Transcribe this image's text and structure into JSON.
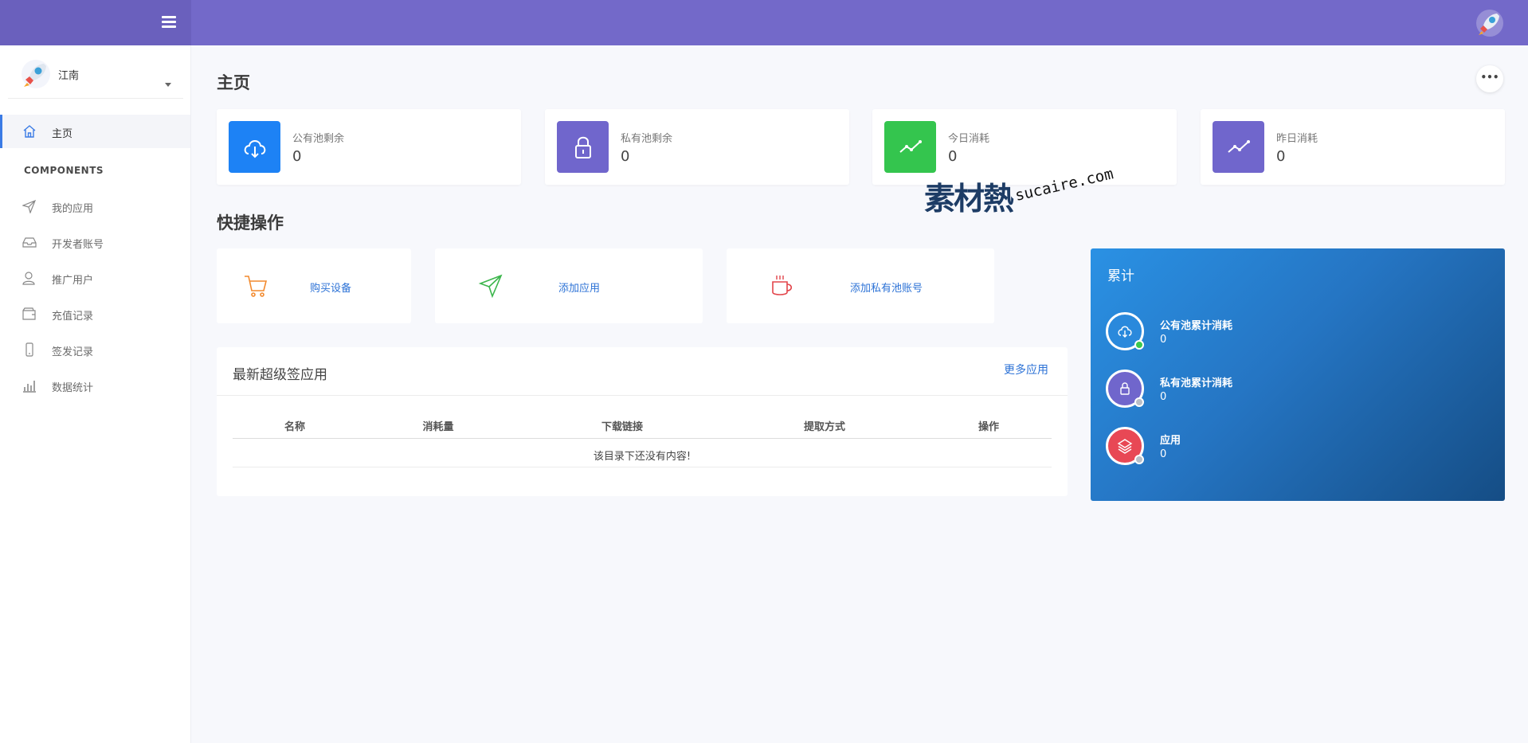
{
  "header": {
    "menu_icon": "menu-icon",
    "avatar_icon": "rocket-avatar-icon"
  },
  "sidebar": {
    "user_name": "江南",
    "active": {
      "label": "主页",
      "icon": "home-icon"
    },
    "section": "COMPONENTS",
    "items": [
      {
        "label": "我的应用",
        "icon": "send-icon"
      },
      {
        "label": "开发者账号",
        "icon": "inbox-icon"
      },
      {
        "label": "推广用户",
        "icon": "user-icon"
      },
      {
        "label": "充值记录",
        "icon": "wallet-icon"
      },
      {
        "label": "签发记录",
        "icon": "phone-icon"
      },
      {
        "label": "数据统计",
        "icon": "bar-chart-icon"
      }
    ]
  },
  "page": {
    "title": "主页",
    "more_icon": "more-icon"
  },
  "stats": [
    {
      "label": "公有池剩余",
      "value": "0",
      "icon": "cloud-download-icon",
      "color": "#1d82f5"
    },
    {
      "label": "私有池剩余",
      "value": "0",
      "icon": "lock-icon",
      "color": "#7066cc"
    },
    {
      "label": "今日消耗",
      "value": "0",
      "icon": "trend-icon",
      "color": "#34c54e"
    },
    {
      "label": "昨日消耗",
      "value": "0",
      "icon": "trend-icon",
      "color": "#7066cc"
    }
  ],
  "quick": {
    "title": "快捷操作",
    "items": [
      {
        "label": "购买设备",
        "icon": "cart-icon",
        "color": "#f28a2e"
      },
      {
        "label": "添加应用",
        "icon": "send-icon",
        "color": "#3cb64c"
      },
      {
        "label": "添加私有池账号",
        "icon": "cup-icon",
        "color": "#e2454b"
      }
    ]
  },
  "apps": {
    "title": "最新超级签应用",
    "more": "更多应用",
    "columns": [
      "名称",
      "消耗量",
      "下载链接",
      "提取方式",
      "操作"
    ],
    "empty": "该目录下还没有内容!"
  },
  "accum": {
    "title": "累计",
    "items": [
      {
        "label": "公有池累计消耗",
        "value": "0",
        "icon": "cloud-download-icon",
        "ring": "#2a89dc",
        "dot": "#3cc84e"
      },
      {
        "label": "私有池累计消耗",
        "value": "0",
        "icon": "lock-icon",
        "ring": "#7066cc",
        "dot": "#b9bec7"
      },
      {
        "label": "应用",
        "value": "0",
        "icon": "layers-icon",
        "ring": "#e84855",
        "dot": "#b9bec7"
      }
    ]
  },
  "watermark": {
    "cn": "素材熱",
    "en": "sucaire.com"
  }
}
